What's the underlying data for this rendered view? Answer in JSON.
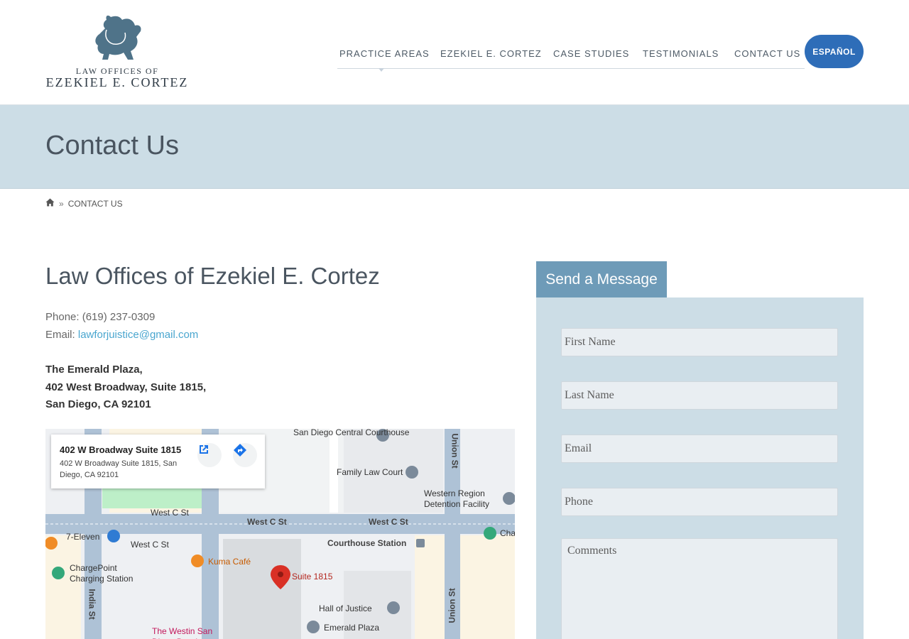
{
  "logo": {
    "line1": "LAW OFFICES OF",
    "line2": "EZEKIEL E. CORTEZ",
    "color": "#4f7389"
  },
  "nav": {
    "items": [
      {
        "label": "PRACTICE AREAS"
      },
      {
        "label": "EZEKIEL E. CORTEZ"
      },
      {
        "label": "CASE STUDIES"
      },
      {
        "label": "TESTIMONIALS"
      },
      {
        "label": "CONTACT US"
      }
    ],
    "language_button": "ESPAÑOL"
  },
  "banner": {
    "title": "Contact Us"
  },
  "breadcrumb": {
    "separator": "»",
    "current": "CONTACT US"
  },
  "contact": {
    "firm_name": "Law Offices of Ezekiel E. Cortez",
    "phone_label": "Phone:",
    "phone": "(619) 237-0309",
    "email_label": "Email:",
    "email": "lawforjuistice@gmail.com",
    "address_lines": [
      "The Emerald Plaza,",
      "402 West Broadway, Suite 1815,",
      "San Diego, CA 92101"
    ]
  },
  "map": {
    "card_title": "402 W Broadway Suite 1815",
    "card_address": "402 W Broadway Suite 1815, San Diego, CA 92101",
    "labels": {
      "courthouse": "San Diego Central Courthouse",
      "family_law": "Family Law Court",
      "western_region": "Western Region Detention Facility",
      "west_c_1": "West C St",
      "west_c_2": "West C St",
      "west_c_3": "West C St",
      "west_c_4": "West C St",
      "seven_eleven": "7-Eleven",
      "courthouse_station": "Courthouse Station",
      "kuma": "Kuma Café",
      "suite": "Suite 1815",
      "chargepoint": "ChargePoint Charging Station",
      "india_st": "India St",
      "union_st_top": "Union St",
      "union_st_bottom": "Union St",
      "hall_of_justice": "Hall of Justice",
      "emerald_plaza": "Emerald Plaza",
      "westin": "The Westin San Diego Bayview",
      "cha": "Cha"
    }
  },
  "form": {
    "tab_label": "Send a Message",
    "first_name": "First Name",
    "last_name": "Last Name",
    "email": "Email",
    "phone": "Phone",
    "comments": "Comments"
  }
}
